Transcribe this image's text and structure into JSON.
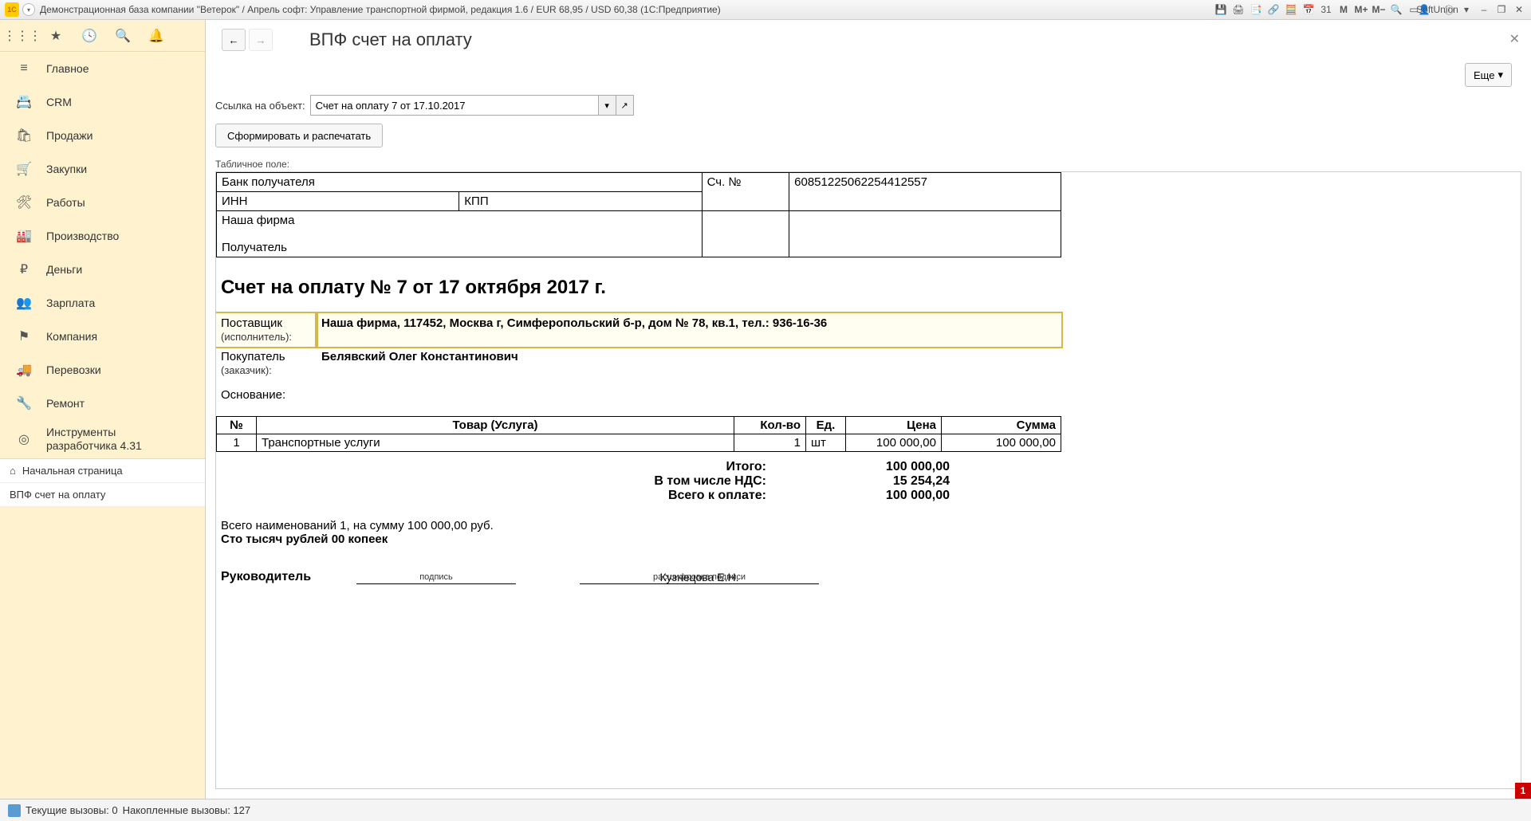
{
  "titlebar": {
    "logo": "1C",
    "title": "Демонстрационная база компании \"Ветерок\" / Апрель софт: Управление транспортной фирмой, редакция 1.6 / EUR 68,95 / USD 60,38  (1С:Предприятие)",
    "user": "SoftUnion"
  },
  "sidebar": {
    "items": [
      {
        "key": "main",
        "label": "Главное",
        "icon": "≡"
      },
      {
        "key": "crm",
        "label": "CRM",
        "icon": "📇"
      },
      {
        "key": "sales",
        "label": "Продажи",
        "icon": "🛍"
      },
      {
        "key": "purchases",
        "label": "Закупки",
        "icon": "🛒"
      },
      {
        "key": "works",
        "label": "Работы",
        "icon": "🛠"
      },
      {
        "key": "production",
        "label": "Производство",
        "icon": "🏭"
      },
      {
        "key": "money",
        "label": "Деньги",
        "icon": "₽"
      },
      {
        "key": "salary",
        "label": "Зарплата",
        "icon": "👥"
      },
      {
        "key": "company",
        "label": "Компания",
        "icon": "⚑"
      },
      {
        "key": "transport",
        "label": "Перевозки",
        "icon": "🚚"
      },
      {
        "key": "repair",
        "label": "Ремонт",
        "icon": "🔧"
      },
      {
        "key": "devtools",
        "label": "Инструменты\nразработчика 4.31",
        "icon": "◎"
      }
    ],
    "open_pages": [
      {
        "label": "Начальная страница",
        "icon": "⌂"
      },
      {
        "label": "ВПФ счет на оплату",
        "icon": ""
      }
    ]
  },
  "page": {
    "title": "ВПФ счет на оплату",
    "more_label": "Еще",
    "link_label": "Ссылка на объект:",
    "link_value": "Счет на оплату 7 от 17.10.2017",
    "form_btn": "Сформировать и распечатать",
    "table_field_label": "Табличное поле:"
  },
  "doc": {
    "bank": {
      "bank_recipient": "Банк получателя",
      "inn": "ИНН",
      "kpp": "КПП",
      "our_company": "Наша фирма",
      "recipient": "Получатель",
      "acc_no_label": "Сч. №",
      "acc_no_value": "60851225062254412557"
    },
    "heading": "Счет на оплату № 7 от 17 октября 2017 г.",
    "supplier_label": "Поставщик",
    "supplier_sub": "(исполнитель):",
    "supplier_value": "Наша фирма,  117452, Москва г, Симферопольский б-р, дом № 78, кв.1,  тел.: 936-16-36",
    "buyer_label": "Покупатель",
    "buyer_sub": "(заказчик):",
    "buyer_value": "Белявский Олег Константинович",
    "basis_label": "Основание:",
    "headers": {
      "num": "№",
      "item": "Товар (Услуга)",
      "qty": "Кол-во",
      "unit": "Ед.",
      "price": "Цена",
      "sum": "Сумма"
    },
    "rows": [
      {
        "num": "1",
        "item": "Транспортные услуги",
        "qty": "1",
        "unit": "шт",
        "price": "100 000,00",
        "sum": "100 000,00"
      }
    ],
    "totals": {
      "total_label": "Итого:",
      "total_val": "100 000,00",
      "vat_label": "В том числе НДС:",
      "vat_val": "15 254,24",
      "pay_label": "Всего к оплате:",
      "pay_val": "100 000,00"
    },
    "summary_line": "Всего наименований 1, на сумму 100 000,00 руб.",
    "summary_words": "Сто тысяч рублей 00 копеек",
    "sign": {
      "role": "Руководитель",
      "signature_caption": "подпись",
      "name": "Кузнецова Е.Н.",
      "name_caption": "расшифровка подписи"
    }
  },
  "statusbar": {
    "current_calls": "Текущие вызовы: 0",
    "accumulated": "Накопленные вызовы: 127"
  },
  "red_badge": "1"
}
